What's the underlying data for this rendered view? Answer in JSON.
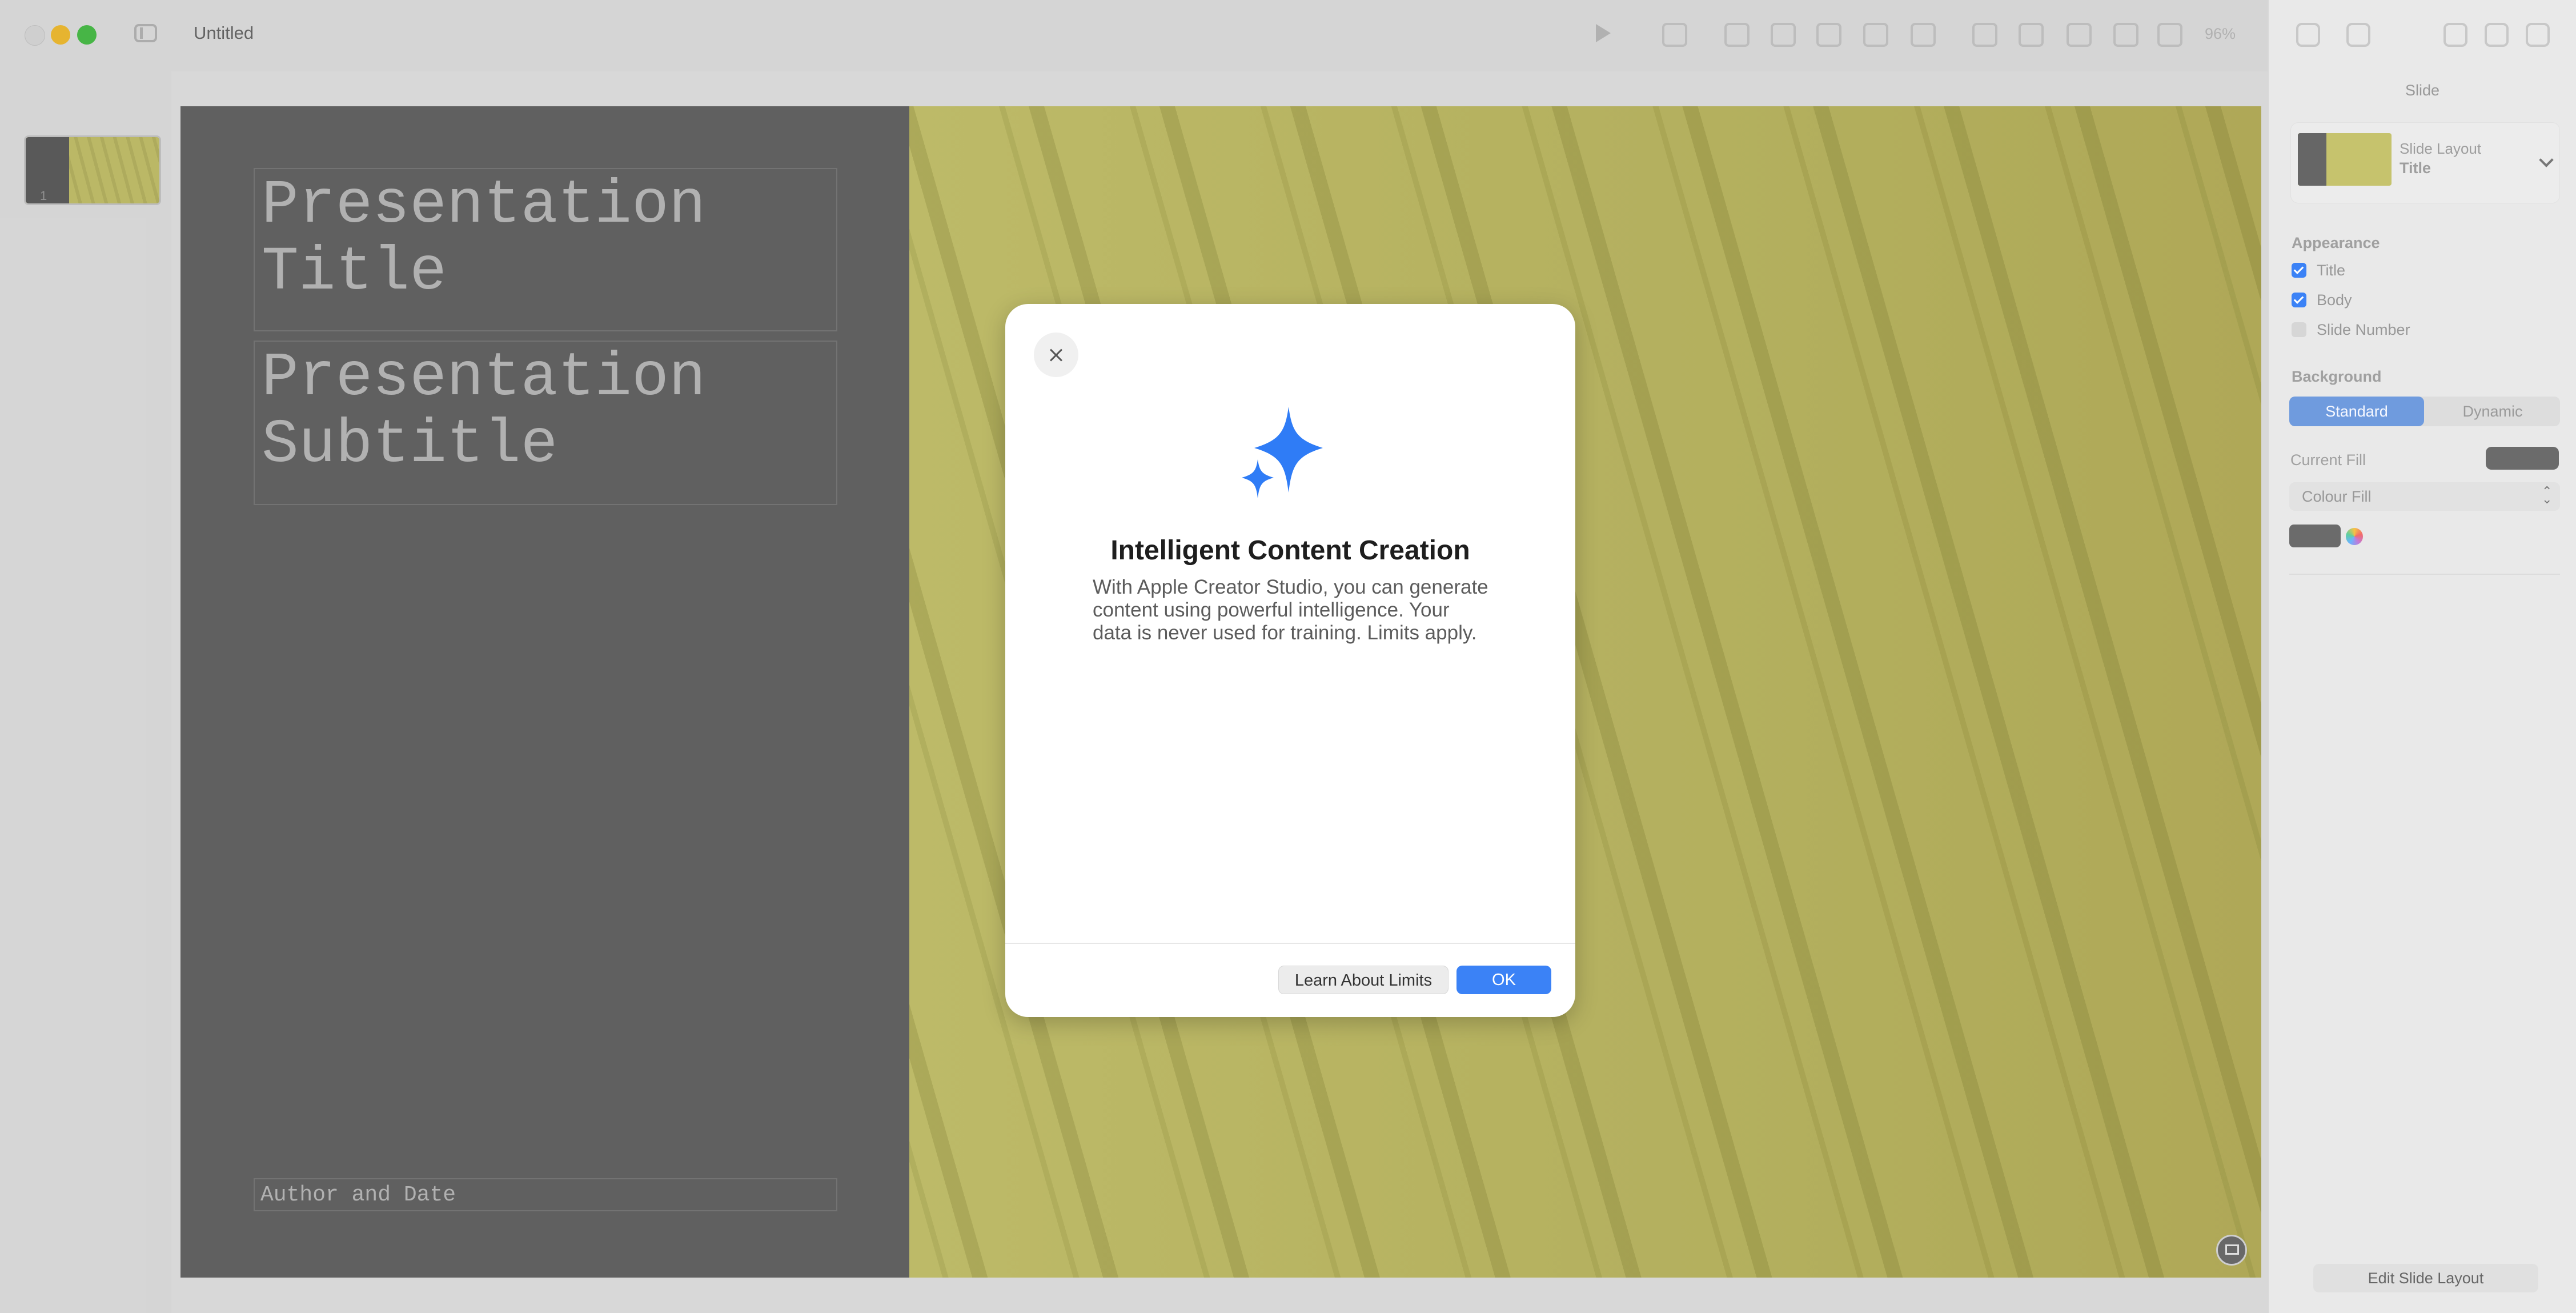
{
  "app": {
    "document_title": "Untitled",
    "zoom_label": "96%"
  },
  "slide_navigator": {
    "slide_number": "1"
  },
  "slide": {
    "title_text": "Presentation\nTitle",
    "subtitle_text": "Presentation\nSubtitle",
    "author_text": "Author and Date"
  },
  "modal": {
    "title": "Intelligent Content Creation",
    "body": "With Apple Creator Studio, you can generate content using powerful intelligence. Your data is never used for training. Limits apply.",
    "learn_button": "Learn About Limits",
    "ok_button": "OK"
  },
  "inspector": {
    "tab_label": "Slide",
    "layout_label": "Slide Layout",
    "layout_value": "Title",
    "appearance_label": "Appearance",
    "checkbox_title": "Title",
    "checkbox_body": "Body",
    "checkbox_slide_number": "Slide Number",
    "background_label": "Background",
    "segment_standard": "Standard",
    "segment_dynamic": "Dynamic",
    "current_fill_label": "Current Fill",
    "fill_type": "Colour Fill",
    "edit_layout_button": "Edit Slide Layout"
  },
  "colors": {
    "accent_blue": "#3b82f6",
    "slide_gray": "#676767",
    "slide_yellow": "#c9c66f"
  },
  "icons": {
    "toolbar": [
      "play-icon",
      "add-slide-icon",
      "shape-icon",
      "chart-icon",
      "media-icon",
      "table-icon",
      "comment-icon",
      "share-icon",
      "format-icon"
    ]
  }
}
